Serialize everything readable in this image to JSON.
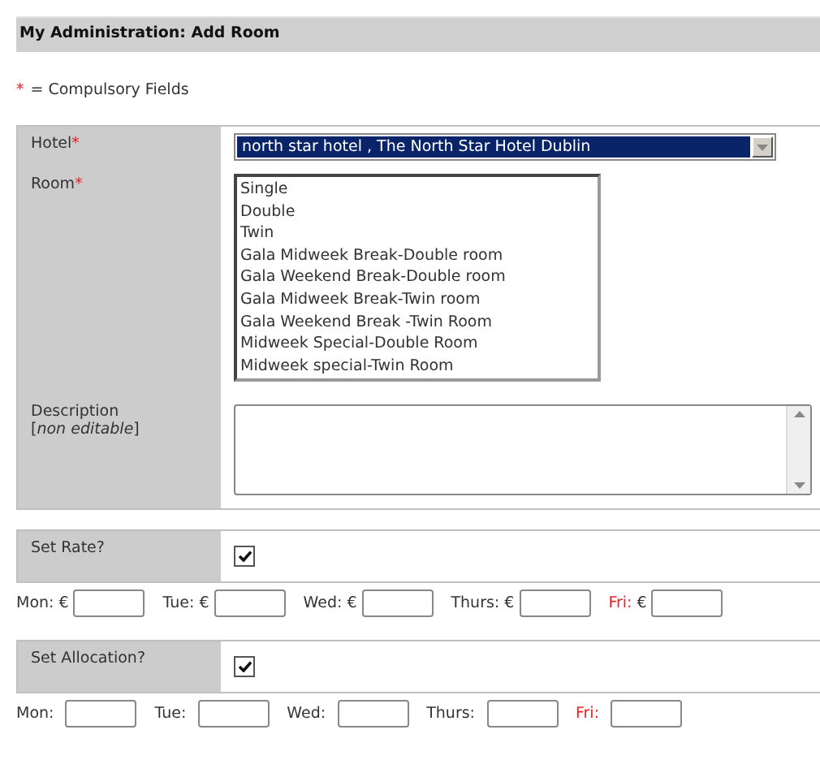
{
  "page_title": "My Administration: Add Room",
  "legend": {
    "mark": "*",
    "text": "= Compulsory Fields"
  },
  "hotel": {
    "label": "Hotel",
    "required": true,
    "value": "north star hotel , The North Star Hotel Dublin"
  },
  "room": {
    "label": "Room",
    "required": true,
    "options": [
      "Single",
      "Double",
      "Twin",
      "Gala Midweek Break-Double room",
      "Gala Weekend Break-Double room",
      "Gala Midweek Break-Twin room",
      "Gala Weekend Break -Twin Room",
      "Midweek Special-Double Room",
      "Midweek special-Twin Room"
    ]
  },
  "description": {
    "label": "Description",
    "note": "[*non editable*]"
  },
  "rate": {
    "label": "Set Rate?",
    "checked": true,
    "currency": "€",
    "days": [
      {
        "label": "Mon:",
        "color": "#333333"
      },
      {
        "label": "Tue:",
        "color": "#333333"
      },
      {
        "label": "Wed:",
        "color": "#333333"
      },
      {
        "label": "Thurs:",
        "color": "#333333"
      },
      {
        "label": "Fri:",
        "color": "#ee2222"
      }
    ]
  },
  "allocation": {
    "label": "Set Allocation?",
    "checked": true,
    "days": [
      {
        "label": "Mon:",
        "color": "#333333"
      },
      {
        "label": "Tue:",
        "color": "#333333"
      },
      {
        "label": "Wed:",
        "color": "#333333"
      },
      {
        "label": "Thurs:",
        "color": "#333333"
      },
      {
        "label": "Fri:",
        "color": "#ee2222"
      }
    ]
  }
}
